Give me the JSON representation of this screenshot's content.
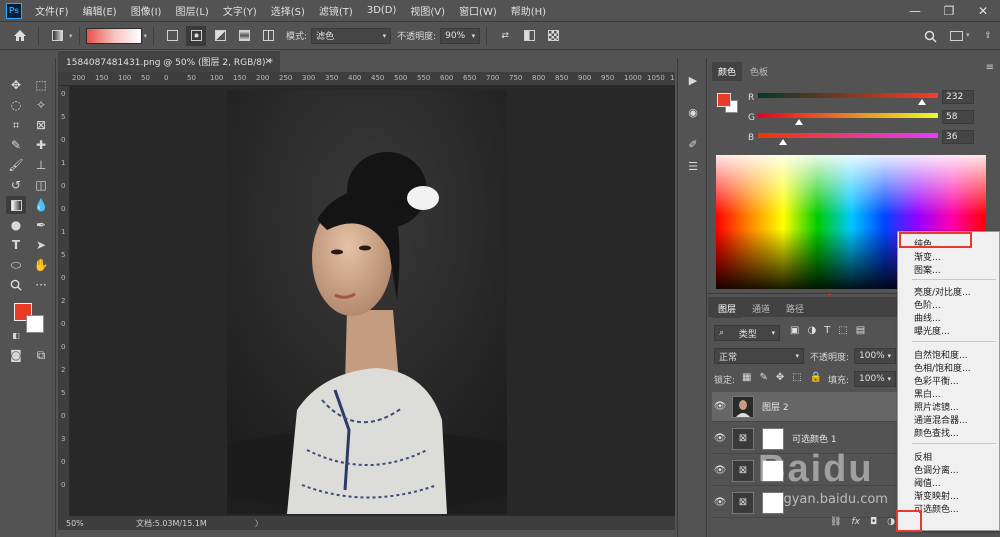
{
  "menubar": {
    "logo": "Ps",
    "items": [
      "文件(F)",
      "编辑(E)",
      "图像(I)",
      "图层(L)",
      "文字(Y)",
      "选择(S)",
      "滤镜(T)",
      "3D(D)",
      "视图(V)",
      "窗口(W)",
      "帮助(H)"
    ]
  },
  "options": {
    "mode_label": "模式:",
    "mode_value": "滤色",
    "opacity_label": "不透明度:",
    "opacity_value": "90%"
  },
  "document": {
    "tab_title": "1584087481431.png @ 50% (图层 2, RGB/8) *",
    "zoom": "50%",
    "doc_size": "文档:5.03M/15.1M",
    "ruler_h": [
      "200",
      "150",
      "100",
      "50",
      "0",
      "50",
      "100",
      "150",
      "200",
      "250",
      "300",
      "350",
      "400",
      "450",
      "500",
      "550",
      "600",
      "650",
      "700",
      "750",
      "800",
      "850",
      "900",
      "950",
      "1000",
      "1050",
      "1100"
    ],
    "ruler_v": [
      "0",
      "5",
      "0",
      "1",
      "0",
      "0",
      "1",
      "5",
      "0",
      "2",
      "0",
      "0",
      "2",
      "5",
      "0",
      "3",
      "0",
      "0"
    ]
  },
  "color_panel": {
    "tabs": [
      "颜色",
      "色板"
    ],
    "r_label": "R",
    "r_value": "232",
    "r_fraction": 0.91,
    "g_label": "G",
    "g_value": "58",
    "g_fraction": 0.23,
    "b_label": "B",
    "b_value": "36",
    "b_fraction": 0.14,
    "foreground": "#e83a24"
  },
  "layers_panel": {
    "tabs": [
      "图层",
      "通道",
      "路径"
    ],
    "kind_filter": "类型",
    "blend_mode": "正常",
    "opacity_label": "不透明度:",
    "opacity_value": "100%",
    "lock_label": "锁定:",
    "fill_label": "填充:",
    "fill_value": "100%",
    "layers": [
      {
        "name": "图层 2",
        "selected": true
      },
      {
        "name": "可选颜色 1",
        "selected": false
      },
      {
        "name": "",
        "selected": false
      },
      {
        "name": "",
        "selected": false
      }
    ]
  },
  "context_menu": {
    "group1": [
      "纯色...",
      "渐变...",
      "图案..."
    ],
    "group2": [
      "亮度/对比度...",
      "色阶...",
      "曲线...",
      "曝光度..."
    ],
    "group3": [
      "自然饱和度...",
      "色相/饱和度...",
      "色彩平衡...",
      "黑白...",
      "照片滤镜...",
      "通道混合器...",
      "颜色查找..."
    ],
    "group4": [
      "反相",
      "色调分离...",
      "阈值...",
      "渐变映射...",
      "可选颜色..."
    ]
  },
  "watermark": {
    "text": "Baidu",
    "sub": "jingyan.baidu.com"
  },
  "colors": {
    "accent_red": "#e63a2e"
  }
}
